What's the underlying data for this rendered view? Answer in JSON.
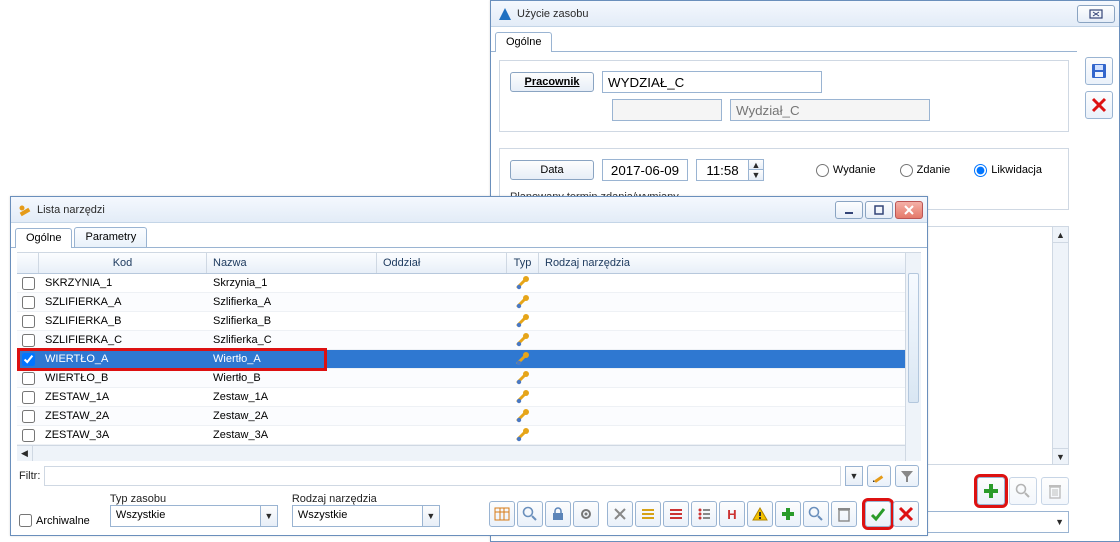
{
  "uz": {
    "title": "Użycie zasobu",
    "tabs": {
      "general": "Ogólne"
    },
    "pracownik_btn": "Pracownik",
    "pracownik_value": "WYDZIAŁ_C",
    "wydzial_placeholder": "Wydział_C",
    "data_btn": "Data",
    "date": "2017-06-09",
    "time": "11:58",
    "radios": {
      "wydanie": "Wydanie",
      "zdanie": "Zdanie",
      "likwidacja": "Likwidacja"
    },
    "radio_selected": "likwidacja",
    "planned_label": "Planowany termin zdania/wymiany"
  },
  "ln": {
    "title": "Lista narzędzi",
    "tabs": {
      "general": "Ogólne",
      "params": "Parametry"
    },
    "headers": {
      "kod": "Kod",
      "nazwa": "Nazwa",
      "oddzial": "Oddział",
      "typ": "Typ",
      "rodzaj": "Rodzaj narzędzia"
    },
    "rows": [
      {
        "kod": "SKRZYNIA_1",
        "nazwa": "Skrzynia_1",
        "checked": false,
        "selected": false
      },
      {
        "kod": "SZLIFIERKA_A",
        "nazwa": "Szlifierka_A",
        "checked": false,
        "selected": false
      },
      {
        "kod": "SZLIFIERKA_B",
        "nazwa": "Szlifierka_B",
        "checked": false,
        "selected": false
      },
      {
        "kod": "SZLIFIERKA_C",
        "nazwa": "Szlifierka_C",
        "checked": false,
        "selected": false
      },
      {
        "kod": "WIERTŁO_A",
        "nazwa": "Wiertło_A",
        "checked": true,
        "selected": true
      },
      {
        "kod": "WIERTŁO_B",
        "nazwa": "Wiertło_B",
        "checked": false,
        "selected": false
      },
      {
        "kod": "ZESTAW_1A",
        "nazwa": "Zestaw_1A",
        "checked": false,
        "selected": false
      },
      {
        "kod": "ZESTAW_2A",
        "nazwa": "Zestaw_2A",
        "checked": false,
        "selected": false
      },
      {
        "kod": "ZESTAW_3A",
        "nazwa": "Zestaw_3A",
        "checked": false,
        "selected": false
      }
    ],
    "filter_label": "Filtr:",
    "archival_label": "Archiwalne",
    "typ_zasobu_label": "Typ zasobu",
    "typ_zasobu_value": "Wszystkie",
    "rodzaj_label": "Rodzaj narzędzia",
    "rodzaj_value": "Wszystkie"
  },
  "icons": {
    "tool_yellow": "wrench-icon"
  }
}
